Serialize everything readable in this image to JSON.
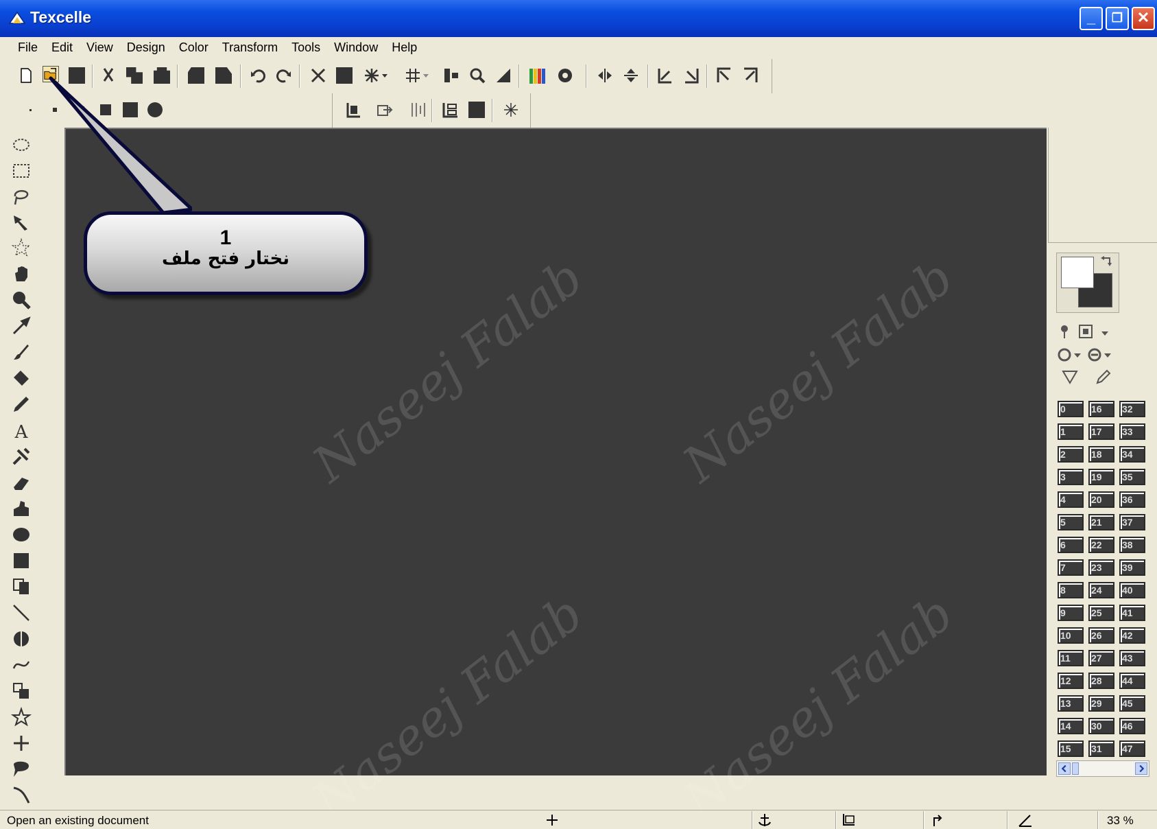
{
  "window": {
    "title": "Texcelle",
    "minimize": "_",
    "maximize": "❐",
    "close": "✕"
  },
  "menu": [
    "File",
    "Edit",
    "View",
    "Design",
    "Color",
    "Transform",
    "Tools",
    "Window",
    "Help"
  ],
  "toolbar": {
    "icons": [
      "new-document-icon",
      "open-folder-icon",
      "save-icon",
      "cut-icon",
      "copy-icon",
      "paste-icon",
      "print-icon",
      "print-preview-icon",
      "undo-icon",
      "redo-icon",
      "transform-icon",
      "fill-square-icon",
      "symmetry-icon",
      "grid-icon",
      "align-icon",
      "zoom-icon",
      "gradient-icon",
      "palette-icon",
      "circle-icon",
      "flip-horizontal-icon",
      "flip-vertical-icon",
      "mirror-left-icon",
      "mirror-right-icon",
      "rotate-left-icon",
      "rotate-right-icon"
    ]
  },
  "brush_sizes": [
    "tiny",
    "small",
    "medium",
    "large",
    "xlarge",
    "round"
  ],
  "secondary_toolbar": [
    "anchor-icon",
    "export-icon",
    "columns-icon",
    "layers-icon",
    "square-icon",
    "star-icon"
  ],
  "tools": [
    "ellipse-select-icon",
    "rect-select-icon",
    "lasso-icon",
    "magic-wand-icon",
    "star-select-icon",
    "hand-icon",
    "zoom-icon",
    "eyedropper-icon",
    "brush-icon",
    "fill-bucket-icon",
    "pencil-icon",
    "text-icon",
    "clone-icon",
    "eraser-icon",
    "smudge-icon",
    "ellipse-icon",
    "rectangle-icon",
    "duplicate-icon",
    "line-icon",
    "circle-half-icon",
    "curve-icon",
    "pattern-icon",
    "star-icon",
    "cross-icon",
    "speech-icon",
    "wand-icon"
  ],
  "callout": {
    "number": "1",
    "text": "نختار فتح ملف"
  },
  "watermark": "Naseej Falab",
  "layers": {
    "col1": [
      "0",
      "1",
      "2",
      "3",
      "4",
      "5",
      "6",
      "7",
      "8",
      "9",
      "10",
      "11",
      "12",
      "13",
      "14",
      "15"
    ],
    "col2": [
      "16",
      "17",
      "18",
      "19",
      "20",
      "21",
      "22",
      "23",
      "24",
      "25",
      "26",
      "27",
      "28",
      "29",
      "30",
      "31"
    ],
    "col3": [
      "32",
      "33",
      "34",
      "35",
      "36",
      "37",
      "38",
      "39",
      "40",
      "41",
      "42",
      "43",
      "44",
      "45",
      "46",
      "47"
    ]
  },
  "status": {
    "message": "Open an existing document",
    "zoom": "33 %"
  },
  "colors": {
    "canvas": "#3b3b3b",
    "chrome": "#ECE9D8",
    "titlebar": "#0a4fe0"
  }
}
